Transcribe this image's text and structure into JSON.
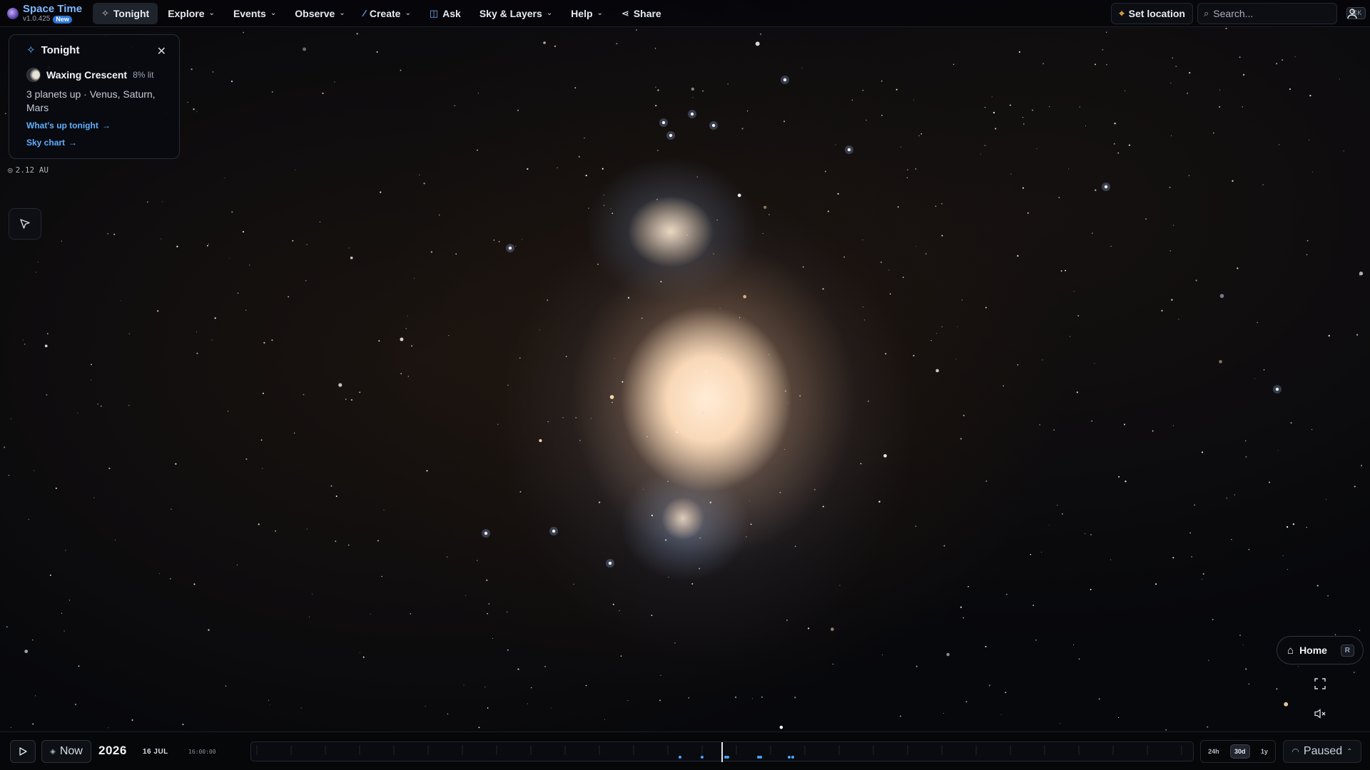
{
  "brand": {
    "title": "Space Time",
    "version": "v1.0.425",
    "badge": "New"
  },
  "nav": [
    {
      "label": "Tonight",
      "icon": "sparkle-icon",
      "active": true,
      "dropdown": false
    },
    {
      "label": "Explore",
      "dropdown": true
    },
    {
      "label": "Events",
      "dropdown": true
    },
    {
      "label": "Observe",
      "dropdown": true
    },
    {
      "label": "Create",
      "icon": "magic-wand-icon",
      "dropdown": true
    },
    {
      "label": "Ask",
      "icon": "robot-icon",
      "dropdown": false
    },
    {
      "label": "Sky & Layers",
      "dropdown": true
    },
    {
      "label": "Help",
      "dropdown": true
    },
    {
      "label": "Share",
      "icon": "share-icon",
      "dropdown": false
    }
  ],
  "topbar": {
    "set_location": "Set location",
    "search_placeholder": "Search...",
    "search_shortcut": "⌘K"
  },
  "tonight_panel": {
    "title": "Tonight",
    "moon_phase": "Waxing Crescent",
    "moon_lit": "8% lit",
    "planets": "3 planets up · Venus, Saturn, Mars",
    "link_whats_up": "What's up tonight",
    "link_sky_chart": "Sky chart"
  },
  "distance": "2.12 AU",
  "home": {
    "label": "Home",
    "shortcut": "R"
  },
  "timeline": {
    "now_label": "Now",
    "year": "2026",
    "date": "16 JUL",
    "time": "16:00:00",
    "scales": [
      "24h",
      "30d",
      "1y"
    ],
    "active_scale": "30d",
    "status": "Paused"
  },
  "colors": {
    "accent": "#5fb0ff",
    "brand": "#7fb8ff",
    "pin": "#f4b040",
    "background": "#07080c"
  }
}
